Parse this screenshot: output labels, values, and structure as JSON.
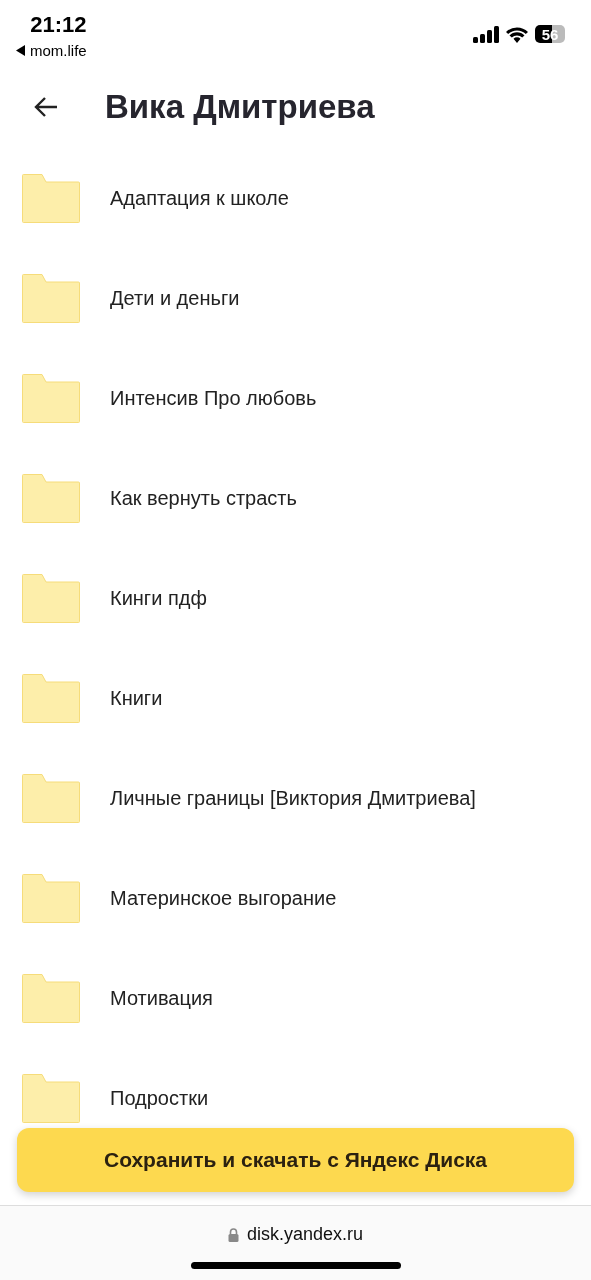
{
  "status_bar": {
    "time": "21:12",
    "back_app": "mom.life",
    "battery": "56"
  },
  "header": {
    "title": "Вика Дмитриева"
  },
  "folders": [
    {
      "name": "Адаптация к школе"
    },
    {
      "name": "Дети и деньги"
    },
    {
      "name": "Интенсив Про любовь"
    },
    {
      "name": "Как вернуть страсть"
    },
    {
      "name": "Кинги пдф"
    },
    {
      "name": "Книги"
    },
    {
      "name": "Личные границы [Виктория Дмитриева]"
    },
    {
      "name": "Материнское выгорание"
    },
    {
      "name": "Мотивация"
    },
    {
      "name": "Подростки"
    }
  ],
  "save_button": {
    "label": "Сохранить и скачать с Яндекс Диска"
  },
  "browser_bar": {
    "url": "disk.yandex.ru"
  }
}
